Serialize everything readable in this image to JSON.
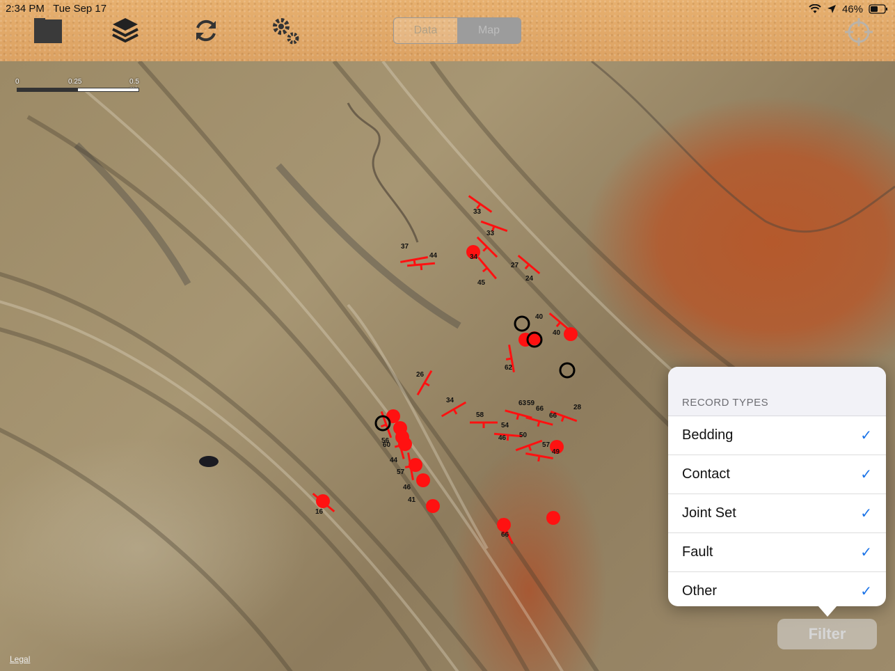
{
  "status_bar": {
    "time": "2:34 PM",
    "date": "Tue Sep 17",
    "battery": "46%"
  },
  "toolbar": {
    "icons": [
      "folder-icon",
      "layers-icon",
      "sync-icon",
      "settings-icon"
    ],
    "segment": {
      "data_label": "Data",
      "map_label": "Map",
      "selected": "Map"
    },
    "locate_icon": "crosshair-icon"
  },
  "scale": {
    "labels": [
      "0",
      "0.25",
      "0.5 mi"
    ]
  },
  "legal_label": "Legal",
  "popover": {
    "header": "RECORD TYPES",
    "items": [
      {
        "label": "Bedding",
        "checked": true
      },
      {
        "label": "Contact",
        "checked": true
      },
      {
        "label": "Joint Set",
        "checked": true
      },
      {
        "label": "Fault",
        "checked": true
      },
      {
        "label": "Other",
        "checked": true
      }
    ]
  },
  "filter_button": "Filter",
  "map_labels": [
    "33",
    "33",
    "37",
    "44",
    "34",
    "27",
    "45",
    "24",
    "40",
    "40",
    "62",
    "26",
    "34",
    "58",
    "63",
    "59",
    "66",
    "66",
    "28",
    "54",
    "50",
    "57",
    "49",
    "56",
    "46",
    "60",
    "44",
    "57",
    "46",
    "41",
    "16",
    "66"
  ],
  "colors": {
    "marker": "#ff1111",
    "check": "#1a73e8",
    "toolbar": "#dca263"
  }
}
